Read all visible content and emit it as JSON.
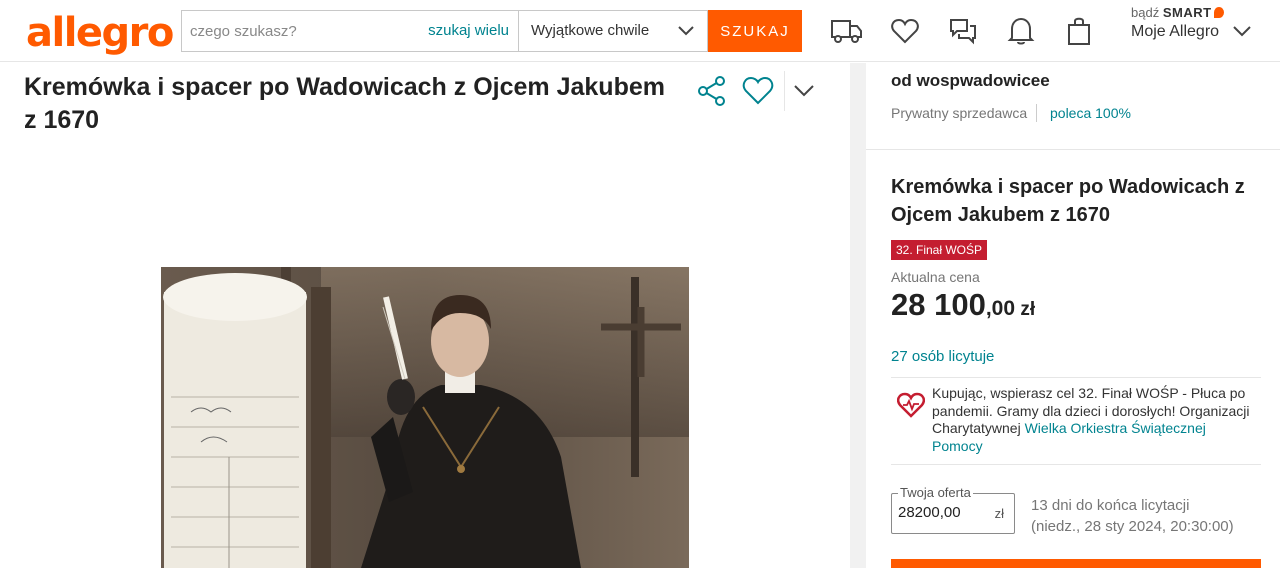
{
  "header": {
    "logo": "allegro",
    "search_placeholder": "czego szukasz?",
    "search_many": "szukaj wielu",
    "category": "Wyjątkowe chwile",
    "search_button": "SZUKAJ",
    "smart_prefix": "bądź",
    "smart_label": "SMART",
    "account": "Moje Allegro",
    "icons": [
      "delivery-truck-icon",
      "heart-icon",
      "messages-icon",
      "bell-icon",
      "shopping-bag-icon"
    ]
  },
  "listing": {
    "title": "Kremówka i spacer po Wadowicach z Ojcem Jakubem z 1670",
    "actions": [
      "share-icon",
      "heart-icon",
      "chevron-down-icon"
    ]
  },
  "seller": {
    "name": "od wospwadowicee",
    "type": "Prywatny sprzedawca",
    "recommend": "poleca 100%"
  },
  "offer": {
    "title": "Kremówka i spacer po Wadowicach z Ojcem Jakubem z 1670",
    "badge": "32. Finał WOŚP",
    "price_label": "Aktualna cena",
    "price_int": "28 100",
    "price_dec": ",00",
    "price_cur": "zł",
    "bidders": "27 osób licytuje",
    "charity_text": "Kupując, wspierasz cel 32. Finał WOŚP - Płuca po pandemii. Gramy dla dzieci i dorosłych! Organizacji Charytatywnej",
    "charity_org": "Wielka Orkiestra Świątecznej Pomocy",
    "bid_label": "Twoja oferta",
    "bid_value": "28200,00",
    "bid_currency": "zł",
    "countdown_line1": "13 dni do końca licytacji",
    "countdown_line2": "(niedz., 28 sty 2024, 20:30:00)"
  },
  "colors": {
    "brand": "#ff5a00",
    "link": "#00838f",
    "badge": "#c41d30"
  }
}
